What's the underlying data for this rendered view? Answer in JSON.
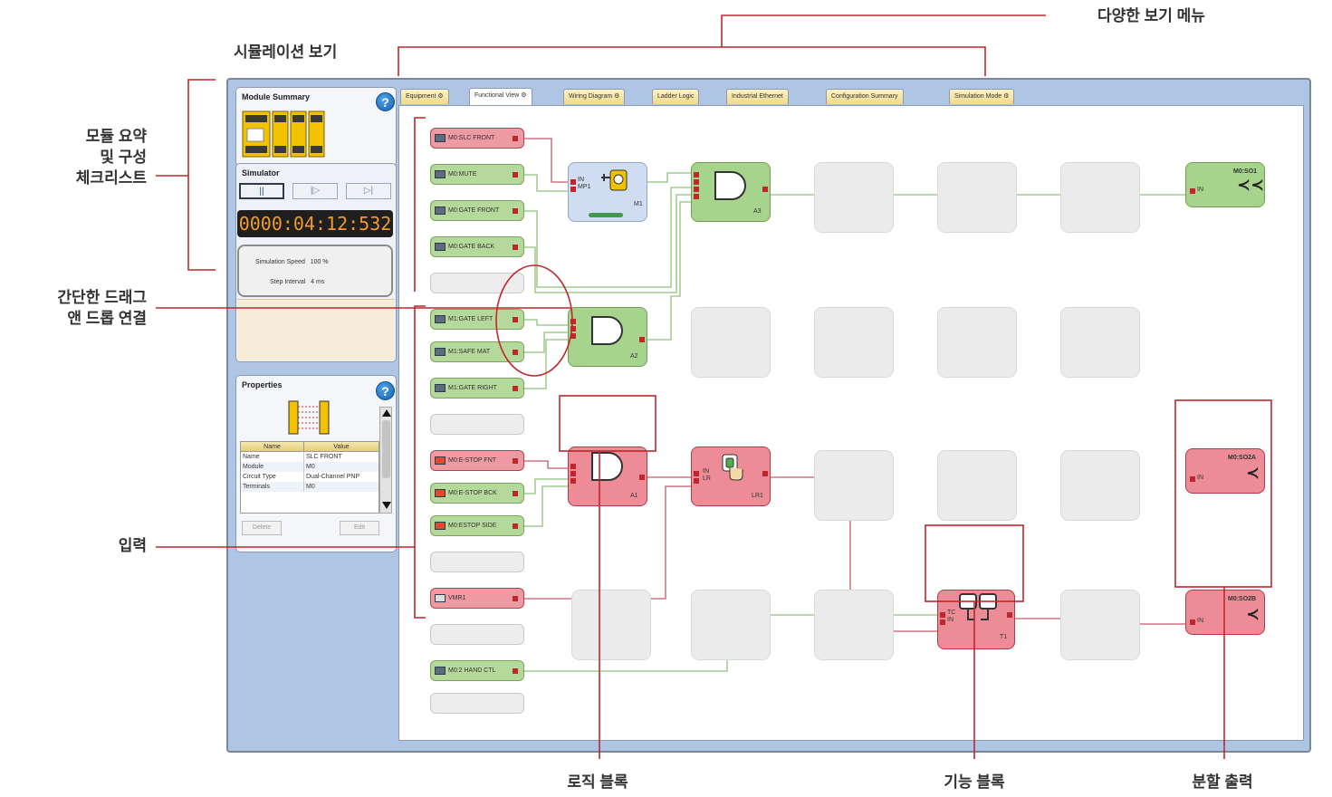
{
  "callouts": {
    "various_view_menu": "다양한 보기 메뉴",
    "simulation_view": "시뮬레이션 보기",
    "module_summary_line1": "모듈 요약",
    "module_summary_line2": "및 구성",
    "module_summary_line3": "체크리스트",
    "drag_drop_line1": "간단한 드래그",
    "drag_drop_line2": "앤 드롭 연결",
    "inputs": "입력",
    "logic_block": "로직 블록",
    "function_block": "기능 블록",
    "split_output": "분할 출력"
  },
  "tabs": [
    {
      "label": "Equipment ⚙",
      "active": false
    },
    {
      "label": "Functional View ⚙",
      "active": true
    },
    {
      "label": "Wiring Diagram ⚙",
      "active": false
    },
    {
      "label": "Ladder Logic",
      "active": false
    },
    {
      "label": "Industrial Ethernet",
      "active": false
    },
    {
      "label": "Configuration Summary",
      "active": false
    },
    {
      "label": "Simulation Mode ⚙",
      "active": false
    }
  ],
  "module_summary": {
    "title": "Module Summary",
    "help_icon": "?"
  },
  "simulator": {
    "title": "Simulator",
    "pause_icon": "||",
    "step_icon": "|▷",
    "reset_icon": "▷|",
    "timer": "0000:04:12:532",
    "speed_label": "Simulation Speed",
    "speed_value": "100 %",
    "interval_label": "Step Interval",
    "interval_value": "4 ms"
  },
  "properties": {
    "title": "Properties",
    "help_icon": "?",
    "col_name": "Name",
    "col_value": "Value",
    "rows": [
      {
        "name": "Name",
        "value": "SLC FRONT"
      },
      {
        "name": "Module",
        "value": "M0"
      },
      {
        "name": "Circuit Type",
        "value": "Dual-Channel PNP"
      },
      {
        "name": "Terminals",
        "value": "M0"
      }
    ],
    "delete_label": "Delete",
    "edit_label": "Edit"
  },
  "inputs": [
    {
      "label": "M0:SLC FRONT",
      "color": "red"
    },
    {
      "label": "M0:MUTE",
      "color": "green"
    },
    {
      "label": "M0:GATE FRONT",
      "color": "green"
    },
    {
      "label": "M0:GATE BACK",
      "color": "green"
    },
    {
      "label": "M1:GATE LEFT",
      "color": "green"
    },
    {
      "label": "M1:SAFE MAT",
      "color": "green"
    },
    {
      "label": "M1:GATE RIGHT",
      "color": "green"
    },
    {
      "label": "M0:E-STOP FNT",
      "color": "red"
    },
    {
      "label": "M0:E-STOP BCK",
      "color": "red"
    },
    {
      "label": "M0:ESTOP SIDE",
      "color": "red"
    },
    {
      "label": "VMR1",
      "color": "red"
    },
    {
      "label": "M0:2 HAND CTL",
      "color": "green"
    }
  ],
  "blocks": {
    "mute_block": {
      "in_label": "IN",
      "mp_label": "MP1",
      "name": "M1"
    },
    "a3": {
      "name": "A3"
    },
    "a2": {
      "name": "A2"
    },
    "a1": {
      "name": "A1"
    },
    "lr1": {
      "in_label": "IN",
      "lr_label": "LR",
      "name": "LR1"
    },
    "t1": {
      "tc_label": "TC",
      "in_label": "IN",
      "name": "T1"
    },
    "so1": {
      "title": "M0:SO1",
      "in_label": "IN"
    },
    "so2a": {
      "title": "M0:SO2A",
      "in_label": "IN"
    },
    "so2b": {
      "title": "M0:SO2B",
      "in_label": "IN"
    }
  },
  "colors": {
    "frame_bg": "#aec6e4",
    "green_block": "#a7d48c",
    "red_block": "#ed8c97",
    "callout_red": "#c0272d",
    "timer_digits": "#f09a2f"
  }
}
